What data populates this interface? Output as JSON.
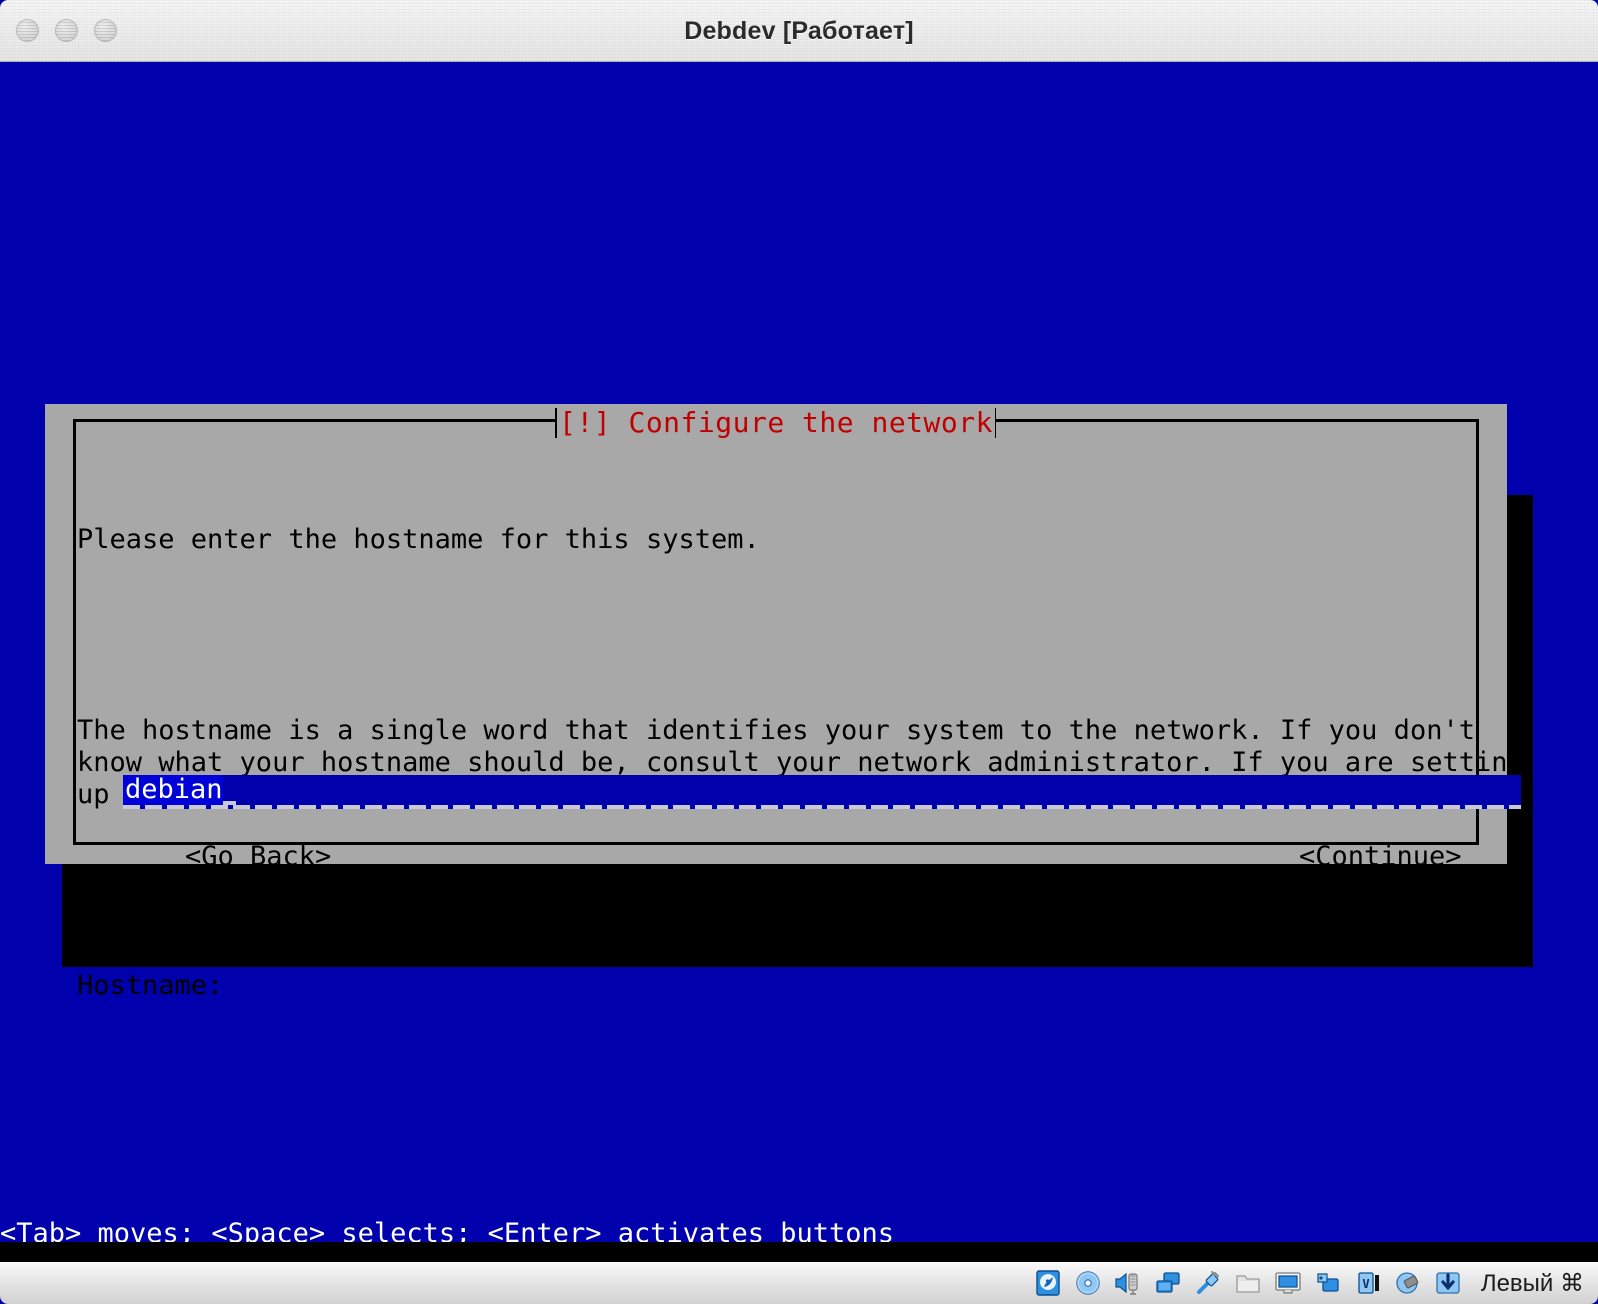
{
  "window": {
    "title": "Debdev [Работает]",
    "traffic_lights": [
      "close",
      "minimize",
      "zoom"
    ]
  },
  "installer": {
    "dialog_title": "[!] Configure the network",
    "title_color": "#c00000",
    "background_color": "#a8a8a8",
    "screen_color": "#0000ac",
    "paragraphs": [
      "Please enter the hostname for this system.",
      "The hostname is a single word that identifies your system to the network. If you don't\nknow what your hostname should be, consult your network administrator. If you are setting\nup your own home network, you can make something up here."
    ],
    "field_label": "Hostname:",
    "hostname_value": "debian",
    "hostname_placeholder": "",
    "buttons": {
      "go_back": "<Go Back>",
      "continue": "<Continue>"
    },
    "status_hint": "<Tab> moves; <Space> selects; <Enter> activates buttons"
  },
  "taskbar": {
    "icons": [
      "hard-disk-icon",
      "optical-disc-icon",
      "audio-icon",
      "network-icon",
      "usb-icon",
      "shared-folder-icon",
      "display-icon",
      "video-capture-icon",
      "virtualbox-logo-icon",
      "remote-session-icon",
      "download-icon"
    ],
    "host_key_label": "Левый ⌘"
  }
}
